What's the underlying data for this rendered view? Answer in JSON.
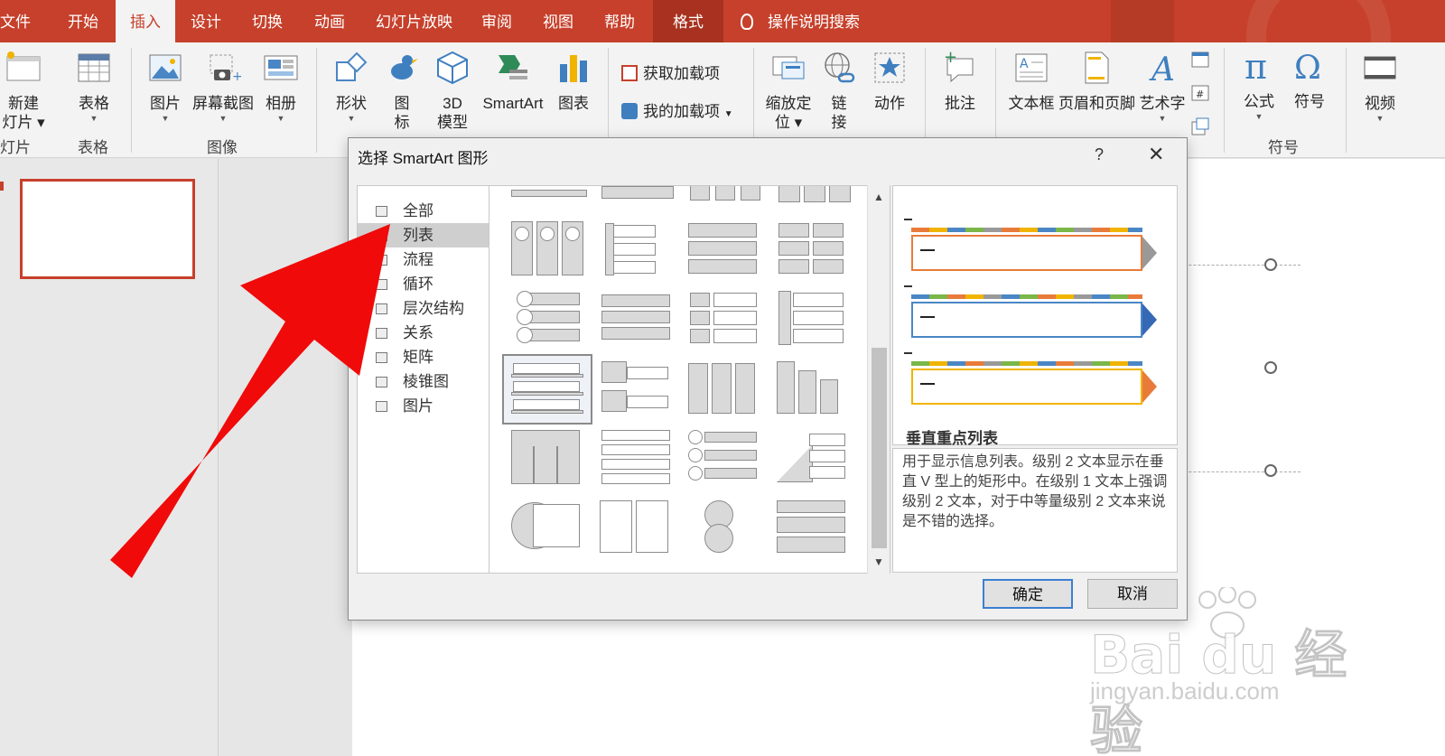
{
  "tabs": [
    "文件",
    "开始",
    "插入",
    "设计",
    "切换",
    "动画",
    "幻灯片放映",
    "审阅",
    "视图",
    "帮助",
    "格式"
  ],
  "active_tab": "插入",
  "search_tell": "操作说明搜索",
  "ribbon": {
    "new_slide": "新建",
    "new_slide2": "灯片",
    "table": "表格",
    "picture": "图片",
    "screenshot": "屏幕截图",
    "album": "相册",
    "shapes": "形状",
    "icons": "图",
    "icons2": "标",
    "model3d": "3D",
    "model3d2": "模型",
    "smartart": "SmartArt",
    "chart": "图表",
    "get_addins": "获取加载项",
    "my_addins": "我的加载项",
    "zoom": "缩放定",
    "zoom2": "位",
    "link": "链",
    "link2": "接",
    "action": "动作",
    "comment": "批注",
    "textbox": "文本框",
    "header_footer": "页眉和页脚",
    "wordart": "艺术字",
    "equation": "公式",
    "symbol": "符号",
    "video": "视频",
    "groups": {
      "slides": "灯片",
      "tables": "表格",
      "images": "图像",
      "symbols": "符号"
    }
  },
  "dialog": {
    "title": "选择 SmartArt 图形",
    "help": "?",
    "close": "✕",
    "categories": [
      "全部",
      "列表",
      "流程",
      "循环",
      "层次结构",
      "关系",
      "矩阵",
      "棱锥图",
      "图片"
    ],
    "selected_category": "列表",
    "selected_name": "垂直重点列表",
    "description": "用于显示信息列表。级别 2 文本显示在垂直 V 型上的矩形中。在级别 1 文本上强调级别 2 文本，对于中等量级别 2 文本来说是不错的选择。",
    "ok": "确定",
    "cancel": "取消",
    "preview_dash": "—"
  },
  "watermark": {
    "brand": "Bai du 经验",
    "url": "jingyan.baidu.com"
  },
  "colors": {
    "accent": "#c6402b",
    "arrow": "#f00a0a"
  }
}
